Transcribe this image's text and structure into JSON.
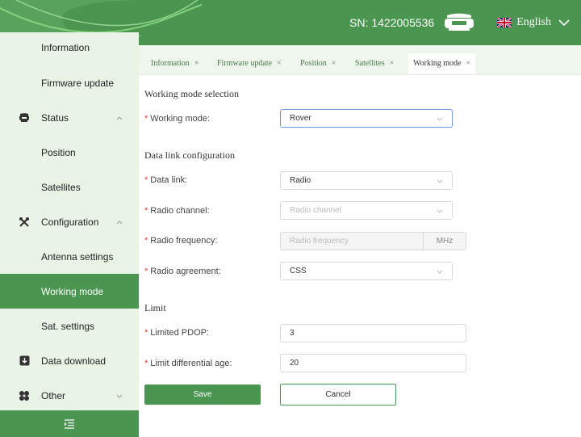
{
  "header": {
    "sn_text": "SN: 1422005536",
    "language": "English",
    "brand_color": "#4a9550"
  },
  "sidebar": {
    "items": [
      {
        "label": "Information",
        "name": "sidebar-item-information"
      },
      {
        "label": "Firmware update",
        "name": "sidebar-item-firmware-update"
      },
      {
        "label": "Status",
        "name": "sidebar-item-status",
        "icon": "receiver-icon"
      },
      {
        "label": "Position",
        "name": "sidebar-item-position"
      },
      {
        "label": "Satellites",
        "name": "sidebar-item-satellites"
      },
      {
        "label": "Configuration",
        "name": "sidebar-item-configuration",
        "icon": "tools-icon"
      },
      {
        "label": "Antenna settings",
        "name": "sidebar-item-antenna-settings"
      },
      {
        "label": "Working mode",
        "name": "sidebar-item-working-mode",
        "active": true
      },
      {
        "label": "Sat. settings",
        "name": "sidebar-item-sat-settings"
      },
      {
        "label": "Data download",
        "name": "sidebar-item-data-download",
        "icon": "download-icon"
      },
      {
        "label": "Other",
        "name": "sidebar-item-other",
        "icon": "clover-icon"
      }
    ]
  },
  "tabs": [
    {
      "label": "Information"
    },
    {
      "label": "Firmware update"
    },
    {
      "label": "Position"
    },
    {
      "label": "Satellites"
    },
    {
      "label": "Working mode",
      "active": true
    }
  ],
  "tab_close": "×",
  "form": {
    "section_mode": "Working mode selection",
    "section_link": "Data link configuration",
    "section_limit": "Limit",
    "required_mark": "*",
    "working_mode": {
      "label": "Working mode:",
      "value": "Rover"
    },
    "data_link": {
      "label": "Data link:",
      "value": "Radio"
    },
    "radio_channel": {
      "label": "Radio channel:",
      "placeholder": "Radio channel"
    },
    "radio_frequency": {
      "label": "Radio frequency:",
      "placeholder": "Radio frequency",
      "unit": "MHz"
    },
    "radio_agreement": {
      "label": "Radio agreement:",
      "value": "CSS"
    },
    "limited_pdop": {
      "label": "Limited PDOP:",
      "value": "3"
    },
    "limit_diff_age": {
      "label": "Limit differential age:",
      "value": "20"
    }
  },
  "buttons": {
    "save": "Save",
    "cancel": "Cancel"
  }
}
